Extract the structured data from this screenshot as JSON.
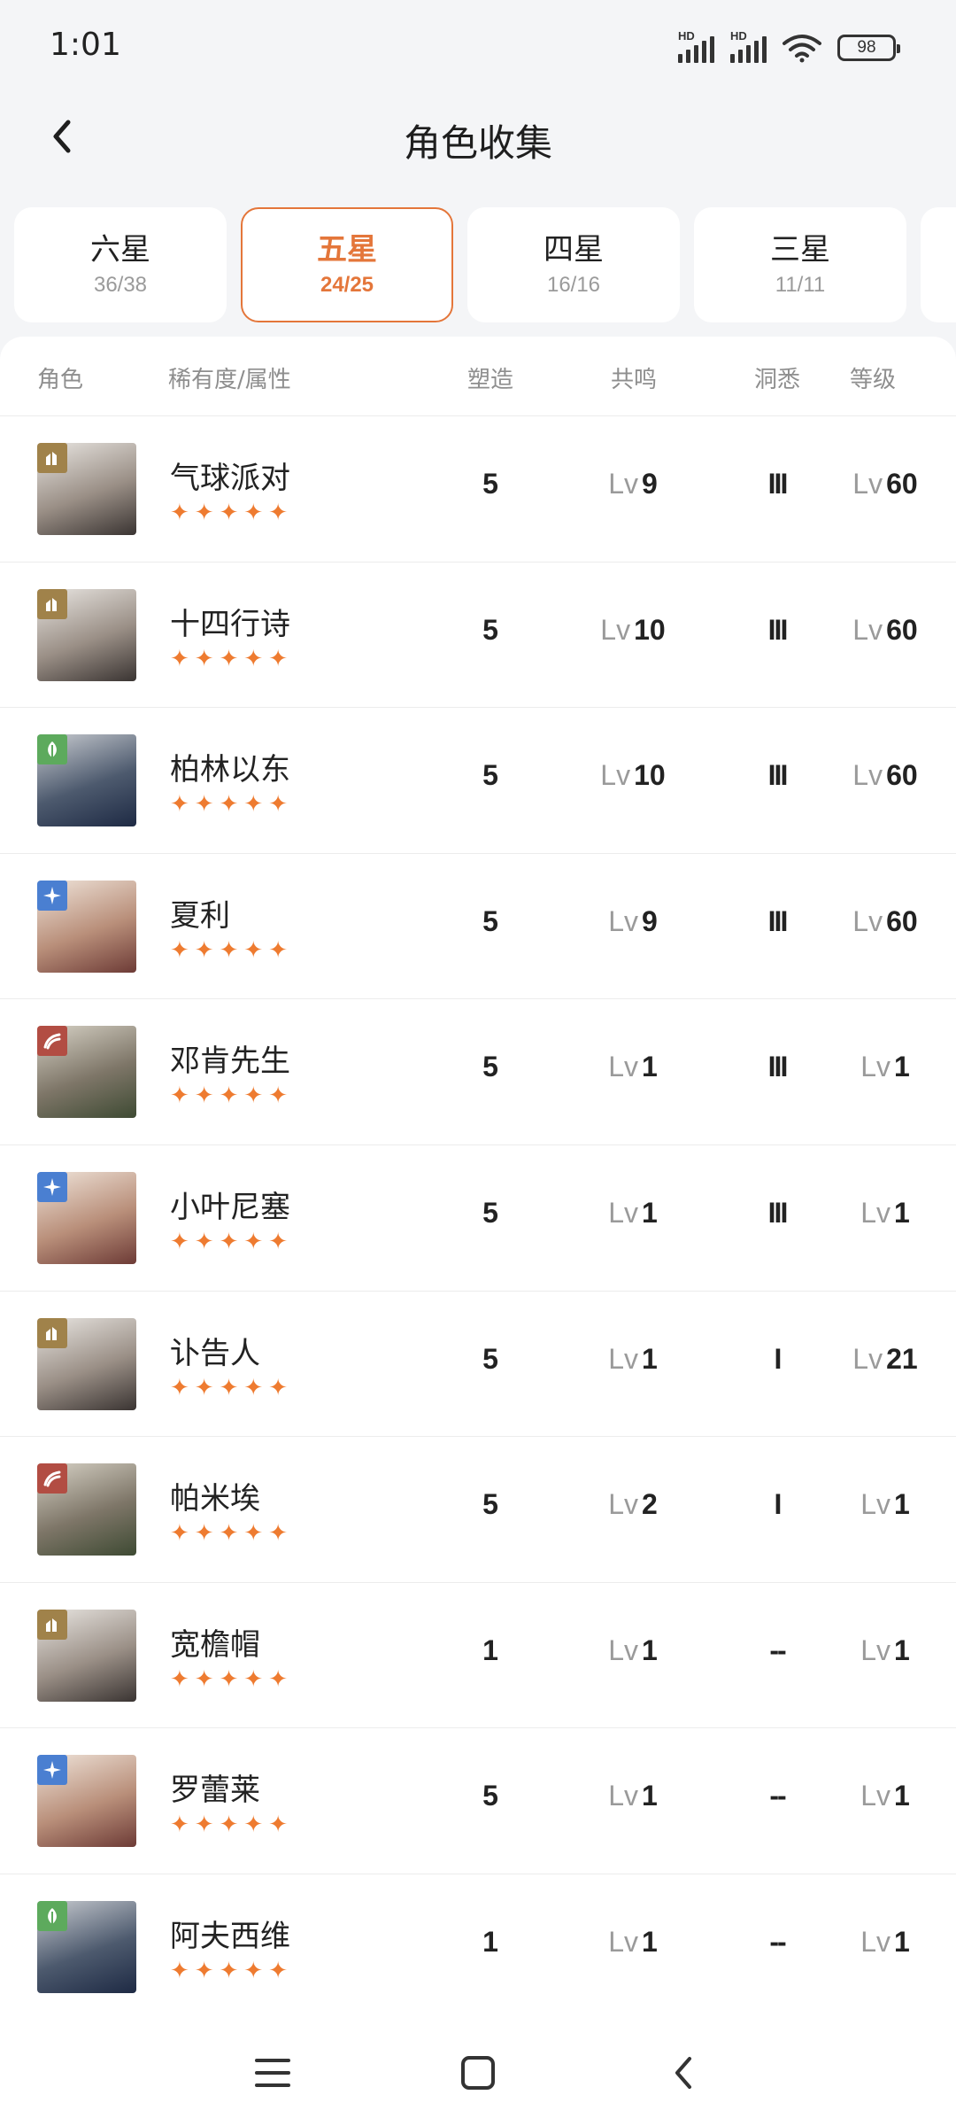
{
  "status": {
    "time": "1:01",
    "signal_label": "HD",
    "battery": "98"
  },
  "header": {
    "title": "角色收集"
  },
  "tabs": [
    {
      "label": "六星",
      "count": "36/38"
    },
    {
      "label": "五星",
      "count": "24/25"
    },
    {
      "label": "四星",
      "count": "16/16"
    },
    {
      "label": "三星",
      "count": "11/11"
    }
  ],
  "columns": {
    "role": "角色",
    "rarity": "稀有度/属性",
    "shape": "塑造",
    "resonance": "共鸣",
    "insight": "洞悉",
    "level": "等级"
  },
  "lv_prefix": "Lv",
  "star_glyph": "✦",
  "colors": {
    "accent": "#e4763a",
    "star": "#ee7b30",
    "beast": "#a0824a",
    "plant": "#5daa5d",
    "star_elem": "#4a7fd1",
    "mineral": "#b24d43"
  },
  "rows": [
    {
      "name": "气球派对",
      "element": "beast",
      "shape": "5",
      "resonance": "9",
      "insight": "III",
      "level": "60"
    },
    {
      "name": "十四行诗",
      "element": "beast",
      "shape": "5",
      "resonance": "10",
      "insight": "III",
      "level": "60"
    },
    {
      "name": "柏林以东",
      "element": "plant",
      "shape": "5",
      "resonance": "10",
      "insight": "III",
      "level": "60"
    },
    {
      "name": "夏利",
      "element": "star",
      "shape": "5",
      "resonance": "9",
      "insight": "III",
      "level": "60"
    },
    {
      "name": "邓肯先生",
      "element": "mineral",
      "shape": "5",
      "resonance": "1",
      "insight": "III",
      "level": "1"
    },
    {
      "name": "小叶尼塞",
      "element": "star",
      "shape": "5",
      "resonance": "1",
      "insight": "III",
      "level": "1"
    },
    {
      "name": "讣告人",
      "element": "beast",
      "shape": "5",
      "resonance": "1",
      "insight": "I",
      "level": "21"
    },
    {
      "name": "帕米埃",
      "element": "mineral",
      "shape": "5",
      "resonance": "2",
      "insight": "I",
      "level": "1"
    },
    {
      "name": "宽檐帽",
      "element": "beast",
      "shape": "1",
      "resonance": "1",
      "insight": "--",
      "level": "1"
    },
    {
      "name": "罗蕾莱",
      "element": "star",
      "shape": "5",
      "resonance": "1",
      "insight": "--",
      "level": "1"
    },
    {
      "name": "阿夫西维",
      "element": "plant",
      "shape": "1",
      "resonance": "1",
      "insight": "--",
      "level": "1"
    }
  ]
}
